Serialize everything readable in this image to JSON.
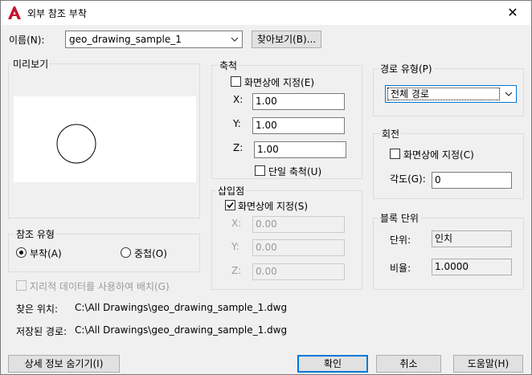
{
  "window": {
    "title": "외부 참조 부착",
    "close_glyph": "✕"
  },
  "name_row": {
    "label": "이름(N):",
    "value": "geo_drawing_sample_1",
    "browse_label": "찾아보기(B)..."
  },
  "preview": {
    "label": "미리보기"
  },
  "scale": {
    "label": "축척",
    "specify_on_screen": "화면상에 지정(E)",
    "x_label": "X:",
    "x_value": "1.00",
    "y_label": "Y:",
    "y_value": "1.00",
    "z_label": "Z:",
    "z_value": "1.00",
    "uniform_scale": "단일 축척(U)"
  },
  "path_type": {
    "label": "경로 유형(P)",
    "value": "전체 경로"
  },
  "rotation": {
    "label": "회전",
    "specify_on_screen": "화면상에 지정(C)",
    "angle_label": "각도(G):",
    "angle_value": "0"
  },
  "insertion_point": {
    "label": "삽입점",
    "specify_on_screen": "화면상에 지정(S)",
    "x_label": "X:",
    "x_value": "0.00",
    "y_label": "Y:",
    "y_value": "0.00",
    "z_label": "Z:",
    "z_value": "0.00"
  },
  "reference_type": {
    "label": "참조 유형",
    "attach": "부착(A)",
    "overlay": "중첩(O)",
    "selected": "attach"
  },
  "geo_location": {
    "label": "지리적 데이터를 사용하여 배치(G)"
  },
  "block_unit": {
    "label": "블록 단위",
    "unit_label": "단위:",
    "unit_value": "인치",
    "factor_label": "비율:",
    "factor_value": "1.0000"
  },
  "paths": {
    "found_label": "찾은 위치:",
    "found_value": "C:\\All Drawings\\geo_drawing_sample_1.dwg",
    "saved_label": "저장된 경로:",
    "saved_value": "C:\\All Drawings\\geo_drawing_sample_1.dwg"
  },
  "buttons": {
    "hide_details": "상세 정보 숨기기(I)",
    "ok": "확인",
    "cancel": "취소",
    "help": "도움말(H)"
  },
  "colors": {
    "app_icon": "#c8102e",
    "focus_border": "#0078d7"
  }
}
